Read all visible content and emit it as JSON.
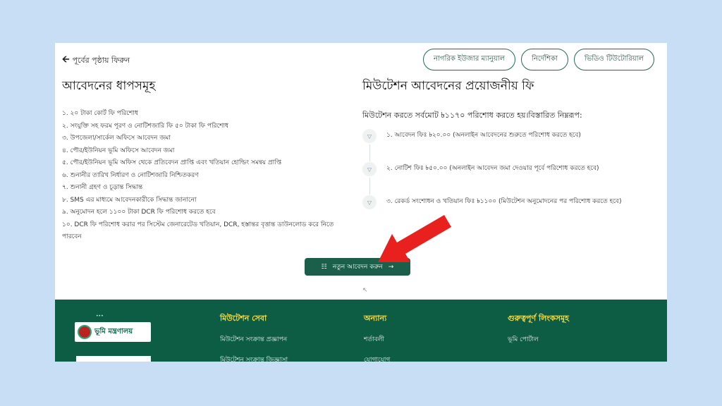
{
  "back_label": "পূর্বের পৃষ্ঠায় ফিরুন",
  "top_buttons": [
    "নাগরিক ইউজার ম্যানুয়াল",
    "নির্দেশিকা",
    "ভিডিও টিউটোরিয়াল"
  ],
  "steps_heading": "আবেদনের ধাপসমূহ",
  "steps": [
    "১. ২০ টাকা কোর্ট ফি পরিশোধ",
    "২. সংযুক্তি সহ ফরম পূরণ ও নোটিশজারি ফি ৫০ টাকা ফি পরিশোধ",
    "৩. উপজেলা/সার্কেল অফিসে আবেদন জমা",
    "৪. পৌর/ইউনিয়ন ভূমি অফিসে আবেদন জমা",
    "৫. পৌর/ইউনিয়ন ভূমি অফিস থেকে প্রতিবেদন প্রাপ্তি এবং খতিয়ান হোল্ডিং সমন্বয় প্রাপ্তি",
    "৬. শুনানীর তারিখ নির্ধারণ ও নোটিশজারি নিশ্চিতকরণ",
    "৭. শুনানী গ্রহণ ও চূড়ান্ত সিদ্ধান্ত",
    "৮. SMS এর মাধ্যমে আবেদনকারীকে সিদ্ধান্ত জানানো",
    "৯. অনুমোদন হলে ১১০০ টাকা DCR ফি পরিশোধ করতে হবে",
    "১০. DCR ফি পরিশোধ করার পর সিস্টেম জেনারেটেড খতিয়ান, DCR, হস্তান্তর বৃত্তান্ত ডাউনলোড করে নিতে পারবেন"
  ],
  "fees_heading": "মিউটেশন আবেদনের প্রয়োজনীয় ফি",
  "fees_subheading": "মিউটেশন করতে সর্বমোট ৳১১৭০ পরিশোধ করতে হয়।বিস্তারিত নিম্নরূপ:",
  "fees": [
    "১. আবেদন ফিঃ ৳২০.০০ (অনলাইন আবেদনের শুরুতে পরিশোধ করতে হবে)",
    "২. নোটিশ ফিঃ ৳৫০.০০ (অনলাইন আবেদন জমা দেওয়ার পূর্বে পরিশোধ করতে হবে)",
    "৩. রেকর্ড সংশোধন ও খতিয়ান ফিঃ ৳১১০০ (মিউটেশন অনুমোদনের পর পরিশোধ করতে হবে)"
  ],
  "new_application_label": "নতুন আবেদন করুন",
  "footer": {
    "logo_text": "ভূমি মন্ত্রণালয়",
    "columns": [
      {
        "title": "মিউটেশন সেবা",
        "links": [
          "মিউটেশন সংক্রান্ত প্রজ্ঞাপন",
          "মিউটেশন সংক্রান্ত জিজ্ঞাসা"
        ]
      },
      {
        "title": "অন্যান্য",
        "links": [
          "শর্তাবলী",
          "যোগাযোগ"
        ]
      },
      {
        "title": "গুরুত্বপূর্ণ লিংকসমূহ",
        "links": [
          "ভূমি পোর্টাল"
        ]
      }
    ]
  },
  "colors": {
    "brand_green": "#1b5e4a",
    "footer_green": "#0d5c44",
    "accent_yellow": "#f3e04c",
    "arrow_red": "#e8211f"
  }
}
